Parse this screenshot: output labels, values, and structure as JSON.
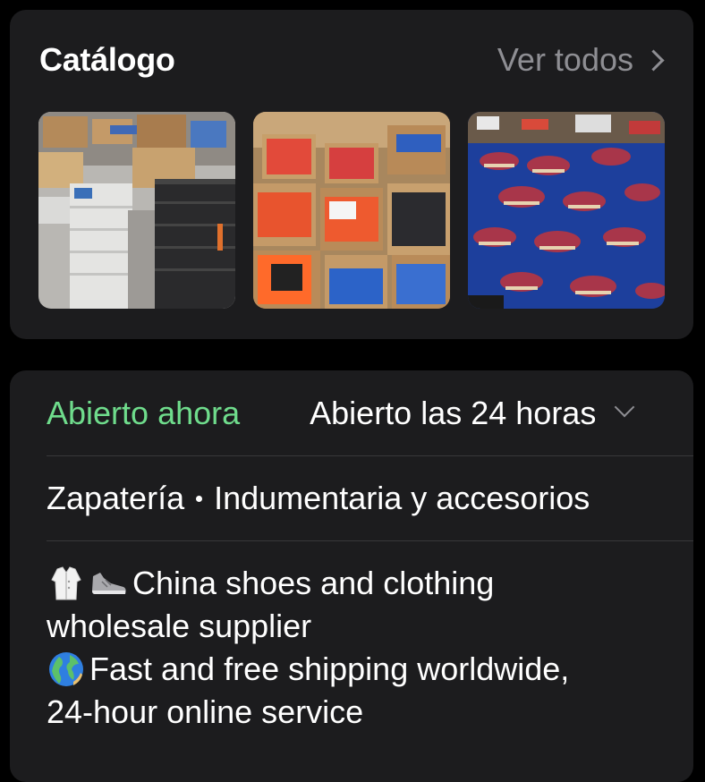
{
  "catalog": {
    "title": "Catálogo",
    "see_all_label": "Ver todos",
    "photos": [
      {
        "icon": "warehouse-shoeboxes-photo"
      },
      {
        "icon": "open-boxes-photo"
      },
      {
        "icon": "sneakers-pile-photo"
      }
    ]
  },
  "info": {
    "open_status": "Abierto ahora",
    "hours": "Abierto las 24 horas",
    "category_1": "Zapatería",
    "category_2": "Indumentaria y accesorios",
    "description": {
      "line1": "China shoes and clothing",
      "line2": "wholesale supplier",
      "line3": "Fast and free shipping worldwide,",
      "line4": "24-hour online service"
    }
  },
  "colors": {
    "background": "#000000",
    "card": "#1c1c1e",
    "open_green": "#6fdc8c",
    "secondary": "#8e8e93"
  }
}
